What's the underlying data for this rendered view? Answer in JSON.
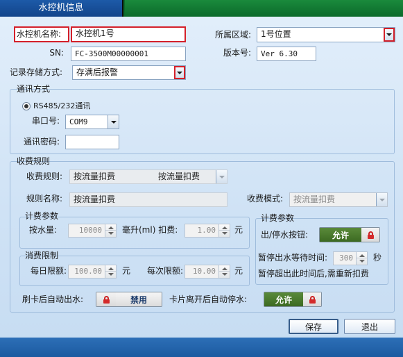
{
  "window": {
    "title": "水控机信息"
  },
  "basic": {
    "name_label": "水控机名称:",
    "name_value": "水控机1号",
    "area_label": "所属区域:",
    "area_value": "1号位置",
    "sn_label": "SN:",
    "sn_value": "FC-3500M00000001",
    "version_label": "版本号:",
    "version_value": "Ver 6.30",
    "storage_label": "记录存储方式:",
    "storage_value": "存满后报警"
  },
  "comm": {
    "group_title": "通讯方式",
    "radio_label": "RS485/232通讯",
    "port_label": "串口号:",
    "port_value": "COM9",
    "password_label": "通讯密码:",
    "password_value": ""
  },
  "billing": {
    "group_title": "收费规则",
    "rule_label": "收费规则:",
    "rule_value": "按流量扣费",
    "rule_value_right": "按流量扣费",
    "rule_name_label": "规则名称:",
    "rule_name_value": "按流量扣费",
    "mode_label": "收费模式:",
    "mode_value": "按流量扣费",
    "params": {
      "group_title": "计费参数",
      "water_label": "按水量:",
      "water_value": "10000",
      "unit_label": "毫升(ml) 扣费:",
      "fee_value": "1.00",
      "fee_unit": "元"
    },
    "limits": {
      "group_title": "消费限制",
      "daily_label": "每日限额:",
      "daily_value": "100.00",
      "daily_unit": "元",
      "each_label": "每次限额:",
      "each_value": "10.00",
      "each_unit": "元"
    },
    "fee_params": {
      "group_title": "计费参数",
      "button_label": "出/停水按钮:",
      "button_state": "允许",
      "wait_label": "暂停出水等待时间:",
      "wait_value": "300",
      "wait_unit": "秒",
      "note": "暂停超出此时间后,需重新扣费"
    },
    "auto_out_label": "刷卡后自动出水:",
    "auto_out_state": "禁用",
    "auto_stop_label": "卡片离开后自动停水:",
    "auto_stop_state": "允许"
  },
  "footer": {
    "save_label": "保存",
    "exit_label": "退出"
  },
  "icons": {
    "lock": "lock-icon",
    "dropdown": "chevron-down-icon",
    "spin": "spin-arrows-icon"
  },
  "colors": {
    "accent_red": "#d4202a",
    "toggle_green": "#3c6a22",
    "titlebar_blue": "#12448a",
    "titlebar_green": "#0b6a2a"
  }
}
